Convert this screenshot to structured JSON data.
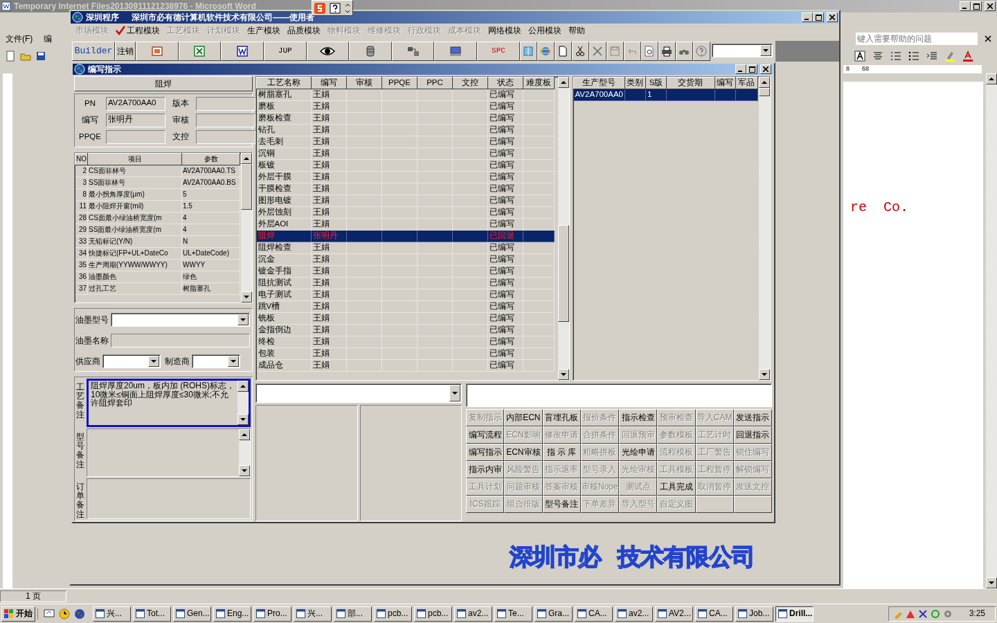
{
  "word": {
    "title": "Temporary Internet Files20130911121238976 - Microsoft Word",
    "menu": [
      "文件(F)",
      "编"
    ],
    "help_placeholder": "键入需要帮助的问题",
    "ruler": [
      "8",
      "68"
    ],
    "doc_text": "re  Co.",
    "status_page": "1 页"
  },
  "app": {
    "title": "深圳程序",
    "caption": "深圳市必有德计算机软件技术有限公司——使用者",
    "menu": [
      {
        "label": "市场模块",
        "disabled": true,
        "checked": false
      },
      {
        "label": "工程模块",
        "disabled": false,
        "checked": true
      },
      {
        "label": "工艺模块",
        "disabled": true,
        "checked": false
      },
      {
        "label": "计划模块",
        "disabled": true,
        "checked": false
      },
      {
        "label": "生产模块",
        "disabled": false,
        "checked": false
      },
      {
        "label": "品质模块",
        "disabled": false,
        "checked": false
      },
      {
        "label": "物料模块",
        "disabled": true,
        "checked": false
      },
      {
        "label": "维修模块",
        "disabled": true,
        "checked": false
      },
      {
        "label": "行政模块",
        "disabled": true,
        "checked": false
      },
      {
        "label": "成本模块",
        "disabled": true,
        "checked": false
      },
      {
        "label": "网络模块",
        "disabled": false,
        "checked": false
      },
      {
        "label": "公用模块",
        "disabled": false,
        "checked": false
      },
      {
        "label": "帮助",
        "disabled": false,
        "checked": false
      }
    ],
    "toolbar": {
      "builder": "Builder",
      "logout": "注销",
      "jup": "JUP",
      "spc": "SPC"
    }
  },
  "dialog": {
    "title": "编写指示",
    "process": "阻焊",
    "fields": [
      {
        "label": "PN",
        "value": "AV2A700AA0"
      },
      {
        "label": "版本"
      },
      {
        "label": "编写",
        "value": "张明丹"
      },
      {
        "label": "审核"
      },
      {
        "label": "PPQE"
      },
      {
        "label": "文控"
      }
    ],
    "params": {
      "columns": [
        "NO",
        "项目",
        "参数"
      ],
      "rows": [
        [
          "2",
          "CS面菲林号",
          "AV2A700AA0.TS"
        ],
        [
          "3",
          "SS面菲林号",
          "AV2A700AA0.BS"
        ],
        [
          "8",
          "最小拐角厚度(μm)",
          "5"
        ],
        [
          "11",
          "最小阻焊开窗(mil)",
          "1.5"
        ],
        [
          "28",
          "CS面最小绿油桥宽度(m",
          "4"
        ],
        [
          "29",
          "SS面最小绿油桥宽度(m",
          "4"
        ],
        [
          "33",
          "无铅标记(Y/N)",
          "N"
        ],
        [
          "34",
          "快捷标记(FP+UL+DateCo",
          "UL+DateCode)"
        ],
        [
          "35",
          "生产周期(YYWW/WWYY)",
          "WWYY"
        ],
        [
          "36",
          "油墨颜色",
          "绿色"
        ],
        [
          "37",
          "过孔工艺",
          "树脂塞孔"
        ]
      ]
    },
    "ink": [
      {
        "label": "油墨型号",
        "kind": "combo"
      },
      {
        "label": "油墨名称",
        "kind": "text"
      },
      {
        "label": "供应商",
        "kind": "combo"
      },
      {
        "label": "制造商",
        "kind": "combo"
      }
    ],
    "remarks": [
      {
        "label": "工艺备注",
        "text": "阻焊厚度20um，板内加 (ROHS)标志，10微米≤铜面上阻焊厚度≤30微米;不允许阻焊套印",
        "highlighted": true
      },
      {
        "label": "型号备注",
        "highlighted": false
      },
      {
        "label": "订单备注",
        "highlighted": false
      }
    ],
    "steps": {
      "columns": [
        "工艺名称",
        "编写",
        "审核",
        "PPQE",
        "PPC",
        "文控",
        "状态",
        "难度板"
      ],
      "rows": [
        {
          "name": "树脂塞孔",
          "writer": "王娟",
          "status": "已编写",
          "selected": false
        },
        {
          "name": "磨板",
          "writer": "王娟",
          "status": "已编写",
          "selected": false
        },
        {
          "name": "磨板检查",
          "writer": "王娟",
          "status": "已编写",
          "selected": false
        },
        {
          "name": "钻孔",
          "writer": "王娟",
          "status": "已编写",
          "selected": false
        },
        {
          "name": "去毛刺",
          "writer": "王娟",
          "status": "已编写",
          "selected": false
        },
        {
          "name": "沉铜",
          "writer": "王娟",
          "status": "已编写",
          "selected": false
        },
        {
          "name": "板镀",
          "writer": "王娟",
          "status": "已编写",
          "selected": false
        },
        {
          "name": "外层干膜",
          "writer": "王娟",
          "status": "已编写",
          "selected": false
        },
        {
          "name": "干膜检查",
          "writer": "王娟",
          "status": "已编写",
          "selected": false
        },
        {
          "name": "图形电镀",
          "writer": "王娟",
          "status": "已编写",
          "selected": false
        },
        {
          "name": "外层蚀刻",
          "writer": "王娟",
          "status": "已编写",
          "selected": false
        },
        {
          "name": "外层AOI",
          "writer": "王娟",
          "status": "已编写",
          "selected": false
        },
        {
          "name": "阻焊",
          "writer": "张明丹",
          "status": "已回退",
          "selected": true
        },
        {
          "name": "阻焊检查",
          "writer": "王娟",
          "status": "已编写",
          "selected": false
        },
        {
          "name": "沉金",
          "writer": "王娟",
          "status": "已编写",
          "selected": false
        },
        {
          "name": "镀金手指",
          "writer": "王娟",
          "status": "已编写",
          "selected": false
        },
        {
          "name": "阻抗测试",
          "writer": "王娟",
          "status": "已编写",
          "selected": false
        },
        {
          "name": "电子测试",
          "writer": "王娟",
          "status": "已编写",
          "selected": false
        },
        {
          "name": "跳V槽",
          "writer": "王娟",
          "status": "已编写",
          "selected": false
        },
        {
          "name": "铣板",
          "writer": "王娟",
          "status": "已编写",
          "selected": false
        },
        {
          "name": "金指倒边",
          "writer": "王娟",
          "status": "已编写",
          "selected": false
        },
        {
          "name": "终检",
          "writer": "王娟",
          "status": "已编写",
          "selected": false
        },
        {
          "name": "包装",
          "writer": "王娟",
          "status": "已编写",
          "selected": false
        },
        {
          "name": "成品仓",
          "writer": "王娟",
          "status": "已编写",
          "selected": false
        }
      ]
    },
    "models": {
      "columns": [
        "生产型号",
        "类别",
        "S版",
        "交货期",
        "编写",
        "军品"
      ],
      "rows": [
        {
          "model": "AV2A700AA0",
          "s_version": "1",
          "selected": true
        }
      ]
    },
    "buttons": [
      {
        "label": "复制指示",
        "disabled": true
      },
      {
        "label": "内部ECN",
        "disabled": false
      },
      {
        "label": "盲埋孔板",
        "disabled": false
      },
      {
        "label": "报价条件",
        "disabled": true
      },
      {
        "label": "指示检查",
        "disabled": false
      },
      {
        "label": "预审检查",
        "disabled": true
      },
      {
        "label": "导入CAM",
        "disabled": true
      },
      {
        "label": "发送指示",
        "disabled": false
      },
      {
        "label": "编写流程",
        "disabled": false
      },
      {
        "label": "ECN影响",
        "disabled": true
      },
      {
        "label": "修改申请",
        "disabled": true
      },
      {
        "label": "合拼条件",
        "disabled": true
      },
      {
        "label": "回退预审",
        "disabled": true
      },
      {
        "label": "参数模板",
        "disabled": true
      },
      {
        "label": "工艺计时",
        "disabled": true
      },
      {
        "label": "回退指示",
        "disabled": false
      },
      {
        "label": "编写指示",
        "disabled": false
      },
      {
        "label": "ECN审核",
        "disabled": false
      },
      {
        "label": "指 示 库",
        "disabled": false
      },
      {
        "label": "粗略拼板",
        "disabled": true
      },
      {
        "label": "光绘申请",
        "disabled": false
      },
      {
        "label": "流程模板",
        "disabled": true
      },
      {
        "label": "工厂警告",
        "disabled": true
      },
      {
        "label": "锁住编写",
        "disabled": true
      },
      {
        "label": "指示内审",
        "disabled": false
      },
      {
        "label": "风险警告",
        "disabled": true
      },
      {
        "label": "指示退率",
        "disabled": true
      },
      {
        "label": "型号录入",
        "disabled": true
      },
      {
        "label": "光绘审核",
        "disabled": true
      },
      {
        "label": "工具模板",
        "disabled": true
      },
      {
        "label": "工程暂停",
        "disabled": true
      },
      {
        "label": "解锁编写",
        "disabled": true
      },
      {
        "label": "工具计划",
        "disabled": true
      },
      {
        "label": "问题审核",
        "disabled": true
      },
      {
        "label": "答案审核",
        "disabled": true
      },
      {
        "label": "审核Nope",
        "disabled": true
      },
      {
        "label": "测试点",
        "disabled": true
      },
      {
        "label": "工具完成",
        "disabled": false
      },
      {
        "label": "取消暂停",
        "disabled": true
      },
      {
        "label": "发送文控",
        "disabled": true
      },
      {
        "label": "ICS跟踪",
        "disabled": true
      },
      {
        "label": "组合排版",
        "disabled": true
      },
      {
        "label": "型号备注",
        "disabled": false
      },
      {
        "label": "下单差异",
        "disabled": true
      },
      {
        "label": "导入型号",
        "disabled": true
      },
      {
        "label": "自定义图",
        "disabled": true
      }
    ],
    "logo": [
      "深圳市必",
      "技术有限公司"
    ]
  },
  "taskbar": {
    "start": "开始",
    "items": [
      {
        "label": "兴...",
        "selected": false
      },
      {
        "label": "Tot...",
        "selected": false
      },
      {
        "label": "Gen...",
        "selected": false
      },
      {
        "label": "Eng...",
        "selected": false
      },
      {
        "label": "Pro...",
        "selected": false
      },
      {
        "label": "兴...",
        "selected": false
      },
      {
        "label": "部...",
        "selected": false
      },
      {
        "label": "pcb...",
        "selected": false
      },
      {
        "label": "pcb...",
        "selected": false
      },
      {
        "label": "av2...",
        "selected": false
      },
      {
        "label": "Te...",
        "selected": false
      },
      {
        "label": "Gra...",
        "selected": false
      },
      {
        "label": "CA...",
        "selected": false
      },
      {
        "label": "av2...",
        "selected": false
      },
      {
        "label": "AV2...",
        "selected": false
      },
      {
        "label": "CA...",
        "selected": false
      },
      {
        "label": "Job...",
        "selected": false
      },
      {
        "label": "Drill...",
        "selected": true
      }
    ],
    "clock": "3:25"
  }
}
